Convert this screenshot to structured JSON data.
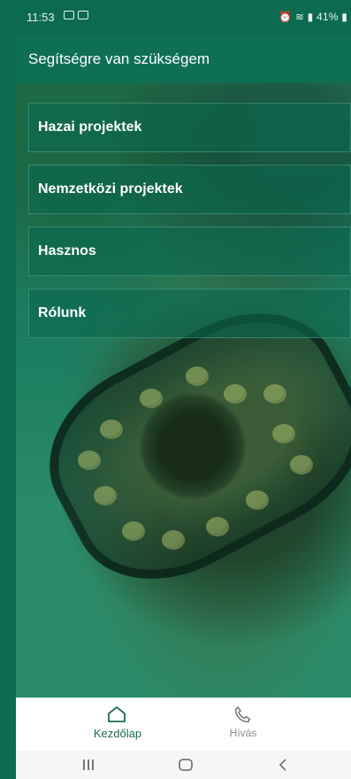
{
  "status_bar": {
    "time": "11:53",
    "right_indicators": "41%"
  },
  "app_bar": {
    "title": "Segítségre van szükségem"
  },
  "menu": {
    "items": [
      {
        "label": "Hazai projektek"
      },
      {
        "label": "Nemzetközi projektek"
      },
      {
        "label": "Hasznos"
      },
      {
        "label": "Rólunk"
      }
    ]
  },
  "bottom_nav": {
    "items": [
      {
        "label": "Kezdőlap",
        "icon": "home-icon",
        "active": true
      },
      {
        "label": "Hívás",
        "icon": "phone-icon",
        "active": false
      }
    ]
  },
  "colors": {
    "primary": "#0f6f54",
    "active_nav": "#1b6b53",
    "inactive_nav": "#8e8e8e"
  }
}
